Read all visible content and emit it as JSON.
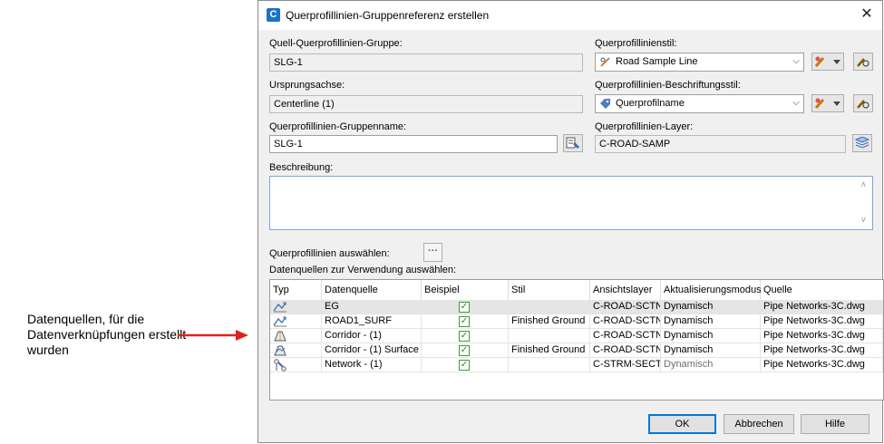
{
  "callout": {
    "text": "Datenquellen, für die Datenverknüpfungen erstellt wurden"
  },
  "dialog": {
    "title": "Querprofillinien-Gruppenreferenz erstellen",
    "app_icon": "C",
    "close_glyph": "✕"
  },
  "form": {
    "source_group": {
      "label": "Quell-Querprofillinien-Gruppe:",
      "value": "SLG-1"
    },
    "origin_axis": {
      "label": "Ursprungsachse:",
      "value": "Centerline (1)"
    },
    "group_name": {
      "label": "Querprofillinien-Gruppenname:",
      "value": "SLG-1"
    },
    "sample_line_style": {
      "label": "Querprofillinienstil:",
      "value": "Road Sample Line"
    },
    "label_style": {
      "label": "Querprofillinien-Beschriftungsstil:",
      "value": "Querprofilname"
    },
    "layer": {
      "label": "Querprofillinien-Layer:",
      "value": "C-ROAD-SAMP"
    },
    "description": {
      "label": "Beschreibung:",
      "value": ""
    },
    "select_lines_label": "Querprofillinien auswählen:",
    "select_sources_label": "Datenquellen zur Verwendung auswählen:",
    "ellipsis": "···"
  },
  "table": {
    "headers": [
      "Typ",
      "Datenquelle",
      "Beispiel",
      "Stil",
      "Ansichtslayer",
      "Aktualisierungsmodus",
      "Quelle"
    ],
    "rows": [
      {
        "type_icon": "surface-icon",
        "source": "EG",
        "sample": true,
        "style": "",
        "layer": "C-ROAD-SCTN",
        "mode": "Dynamisch",
        "mode_muted": false,
        "origin": "Pipe Networks-3C.dwg"
      },
      {
        "type_icon": "surface-icon",
        "source": "ROAD1_SURF",
        "sample": true,
        "style": "Finished Ground",
        "layer": "C-ROAD-SCTN",
        "mode": "Dynamisch",
        "mode_muted": false,
        "origin": "Pipe Networks-3C.dwg"
      },
      {
        "type_icon": "corridor-icon",
        "source": "Corridor - (1)",
        "sample": true,
        "style": "",
        "layer": "C-ROAD-SCTN",
        "mode": "Dynamisch",
        "mode_muted": false,
        "origin": "Pipe Networks-3C.dwg"
      },
      {
        "type_icon": "corridor-surface-icon",
        "source": "Corridor - (1) Surface",
        "sample": true,
        "style": "Finished Ground",
        "layer": "C-ROAD-SCTN",
        "mode": "Dynamisch",
        "mode_muted": false,
        "origin": "Pipe Networks-3C.dwg"
      },
      {
        "type_icon": "pipe-network-icon",
        "source": "Network - (1)",
        "sample": true,
        "style": "",
        "layer": "C-STRM-SECT",
        "mode": "Dynamisch",
        "mode_muted": true,
        "origin": "Pipe Networks-3C.dwg"
      }
    ]
  },
  "buttons": {
    "ok": "OK",
    "cancel": "Abbrechen",
    "help": "Hilfe"
  },
  "colors": {
    "accent": "#0078d7",
    "arrow": "#e02020",
    "check": "#1f8f1f",
    "app_icon": "#1a73c8"
  }
}
